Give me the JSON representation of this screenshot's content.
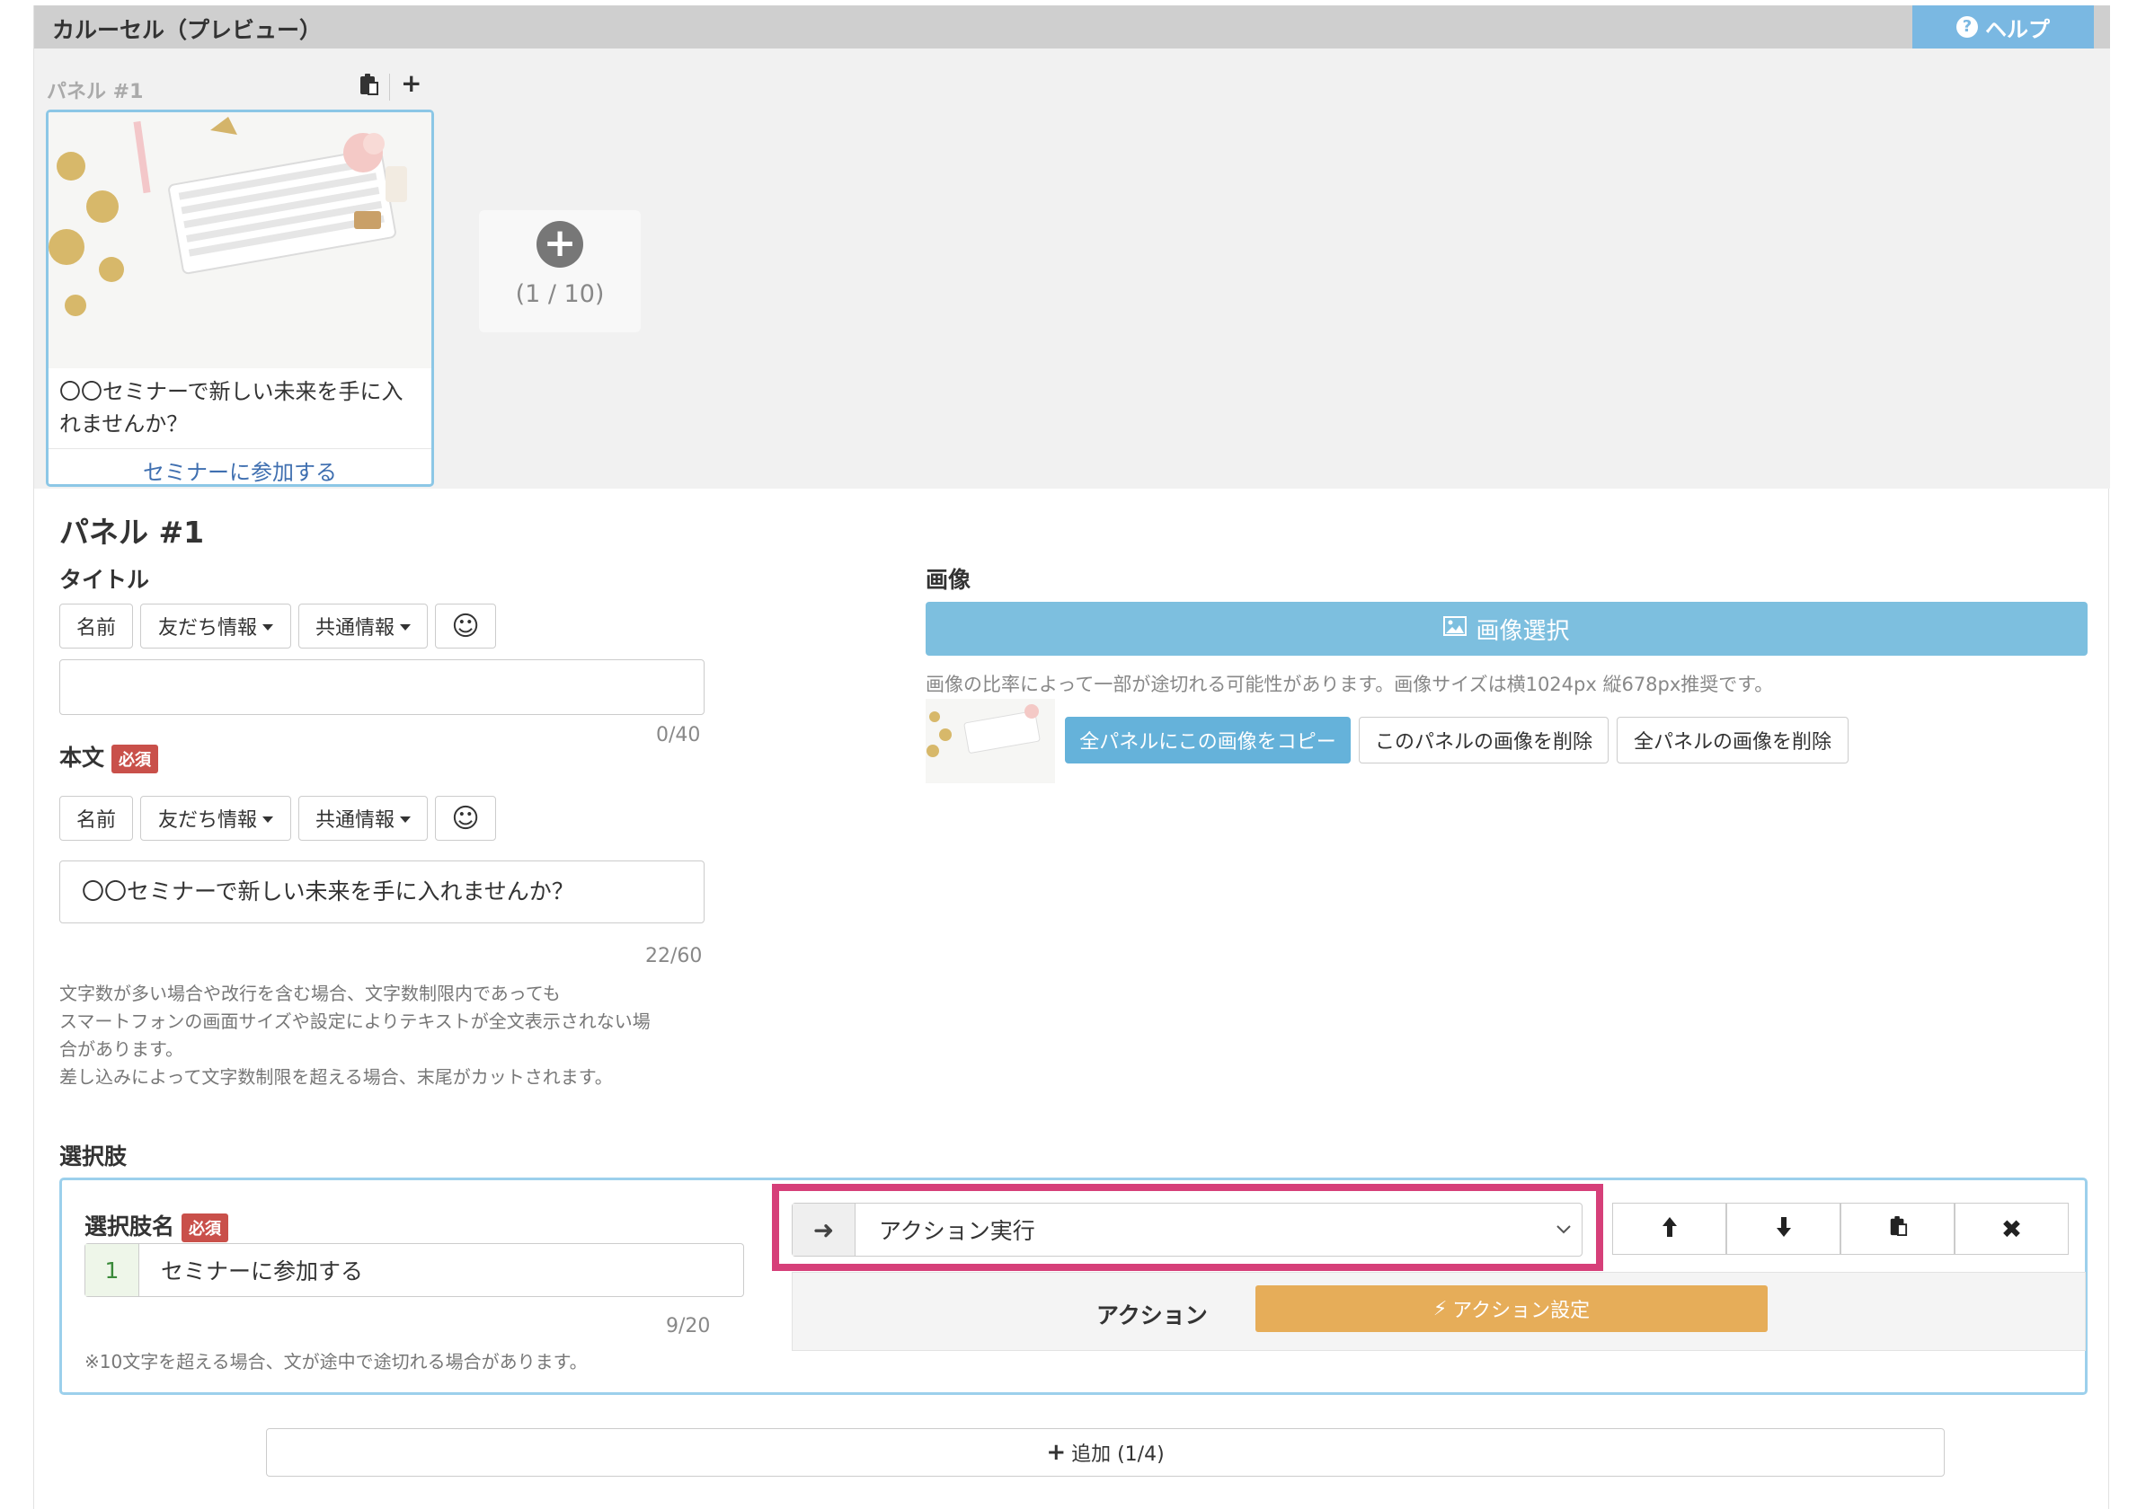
{
  "header": {
    "title": "カルーセル（プレビュー）",
    "help_label": "ヘルプ",
    "help_icon": "?"
  },
  "preview": {
    "panel_label": "パネル #1",
    "card": {
      "title": "〇〇セミナーで新しい未来を手に入れませんか？",
      "link": "セミナーに参加する"
    },
    "add_count": "(1 / 10)"
  },
  "editor": {
    "heading": "パネル #1",
    "title_section": {
      "label": "タイトル",
      "toolbar": {
        "name": "名前",
        "friend": "友だち情報",
        "common": "共通情報"
      },
      "value": "",
      "counter": "0/40"
    },
    "body_section": {
      "label": "本文",
      "required": "必須",
      "toolbar": {
        "name": "名前",
        "friend": "友だち情報",
        "common": "共通情報"
      },
      "value": "〇〇セミナーで新しい未来を手に入れませんか？",
      "counter": "22/60"
    },
    "notes": [
      "文字数が多い場合や改行を含む場合、文字数制限内であっても",
      "スマートフォンの画面サイズや設定によりテキストが全文表示されない場",
      "合があります。",
      "差し込みによって文字数制限を超える場合、末尾がカットされます。"
    ]
  },
  "image_section": {
    "label": "画像",
    "select_button": "画像選択",
    "note": "画像の比率によって一部が途切れる可能性があります。画像サイズは横1024px 縦678px推奨です。",
    "copy_all": "全パネルにこの画像をコピー",
    "delete_this": "このパネルの画像を削除",
    "delete_all": "全パネルの画像を削除"
  },
  "choices": {
    "label": "選択肢",
    "name_label": "選択肢名",
    "required": "必須",
    "number": "1",
    "value": "セミナーに参加する",
    "counter": "9/20",
    "note": "※10文字を超える場合、文が途中で途切れる場合があります。",
    "select_value": "アクション実行",
    "action_label": "アクション",
    "action_button": "アクション設定",
    "add_button": "追加 (1/4)"
  },
  "icons": {
    "arrow_right": "➜",
    "up": "🡅",
    "down": "🡇",
    "paste": "📋",
    "close": "✖",
    "plus": "+",
    "bolt": "⚡",
    "emoji": "☺",
    "chevron": "⌄"
  },
  "colors": {
    "help": "#7ab8e2",
    "image_button": "#7dbfdf",
    "copy_button": "#65b2da",
    "action_button": "#e6ad59",
    "highlight": "#d63f79",
    "required": "#c9504a"
  }
}
